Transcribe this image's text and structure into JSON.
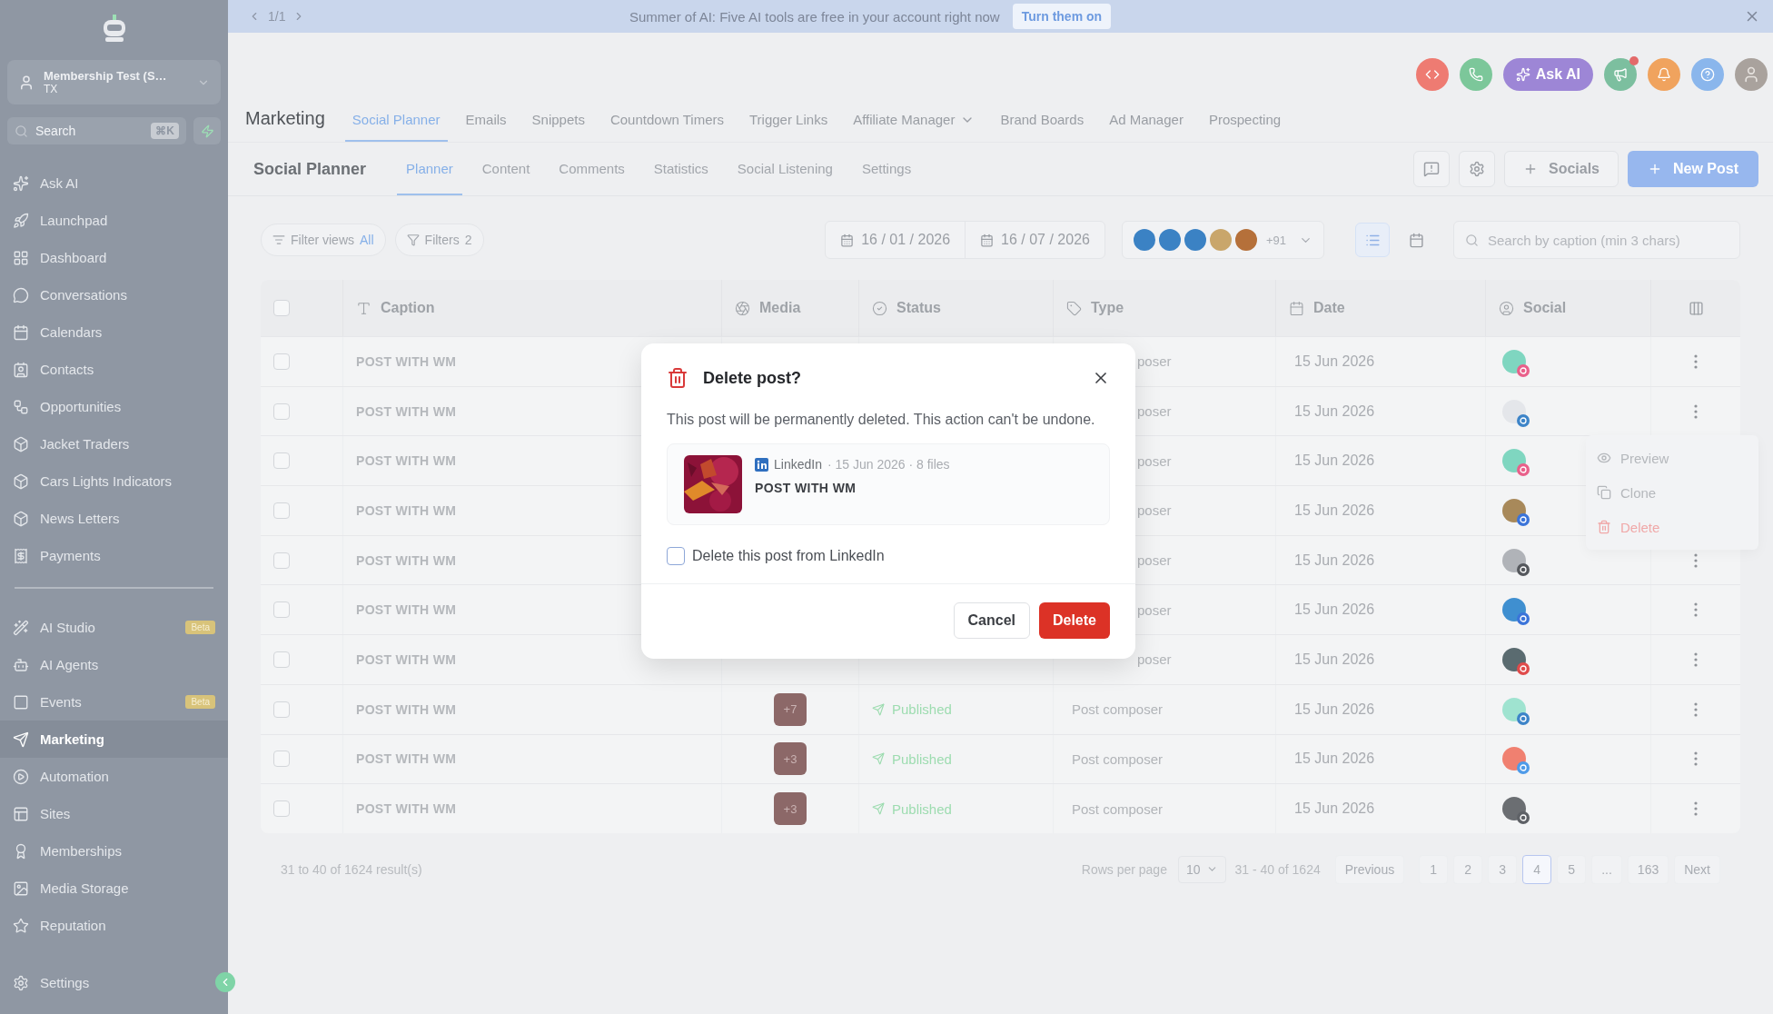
{
  "banner": {
    "pager": "1/1",
    "message": "Summer of AI: Five AI tools are free in your account right now",
    "action": "Turn them on"
  },
  "top_actions": {
    "ask_ai": "Ask AI"
  },
  "sidebar": {
    "account": {
      "name": "Membership Test (S…",
      "location": "TX"
    },
    "search": {
      "placeholder": "Search",
      "shortcut": "⌘K"
    },
    "items": [
      {
        "label": "Ask AI",
        "selected": false
      },
      {
        "label": "Launchpad",
        "selected": false
      },
      {
        "label": "Dashboard",
        "selected": false
      },
      {
        "label": "Conversations",
        "selected": false
      },
      {
        "label": "Calendars",
        "selected": false
      },
      {
        "label": "Contacts",
        "selected": false
      },
      {
        "label": "Opportunities",
        "selected": false
      },
      {
        "label": "Jacket Traders",
        "selected": false
      },
      {
        "label": "Cars Lights Indicators",
        "selected": false
      },
      {
        "label": "News Letters",
        "selected": false
      },
      {
        "label": "Payments",
        "selected": false
      }
    ],
    "items_2": [
      {
        "label": "AI Studio",
        "badge": "Beta",
        "selected": false
      },
      {
        "label": "AI Agents",
        "selected": false
      },
      {
        "label": "Events",
        "badge": "Beta",
        "selected": false
      },
      {
        "label": "Marketing",
        "selected": true
      },
      {
        "label": "Automation",
        "selected": false
      },
      {
        "label": "Sites",
        "selected": false
      },
      {
        "label": "Memberships",
        "selected": false
      },
      {
        "label": "Media Storage",
        "selected": false
      },
      {
        "label": "Reputation",
        "selected": false
      }
    ],
    "settings": "Settings"
  },
  "nav": {
    "title": "Marketing",
    "tabs": [
      {
        "label": "Social Planner",
        "selected": true
      },
      {
        "label": "Emails",
        "selected": false
      },
      {
        "label": "Snippets",
        "selected": false
      },
      {
        "label": "Countdown Timers",
        "selected": false
      },
      {
        "label": "Trigger Links",
        "selected": false
      },
      {
        "label": "Affiliate Manager",
        "dropdown": true,
        "selected": false
      },
      {
        "label": "Brand Boards",
        "selected": false
      },
      {
        "label": "Ad Manager",
        "selected": false
      },
      {
        "label": "Prospecting",
        "selected": false
      }
    ]
  },
  "subnav": {
    "title": "Social Planner",
    "tabs": [
      {
        "label": "Planner",
        "selected": true
      },
      {
        "label": "Content",
        "selected": false
      },
      {
        "label": "Comments",
        "selected": false
      },
      {
        "label": "Statistics",
        "selected": false
      },
      {
        "label": "Social Listening",
        "selected": false
      },
      {
        "label": "Settings",
        "selected": false
      }
    ],
    "socials": "Socials",
    "new_post": "New Post"
  },
  "filters": {
    "filter_views": "Filter views",
    "filter_views_value": "All",
    "filters": "Filters",
    "filters_count": "2",
    "date_from": "16 / 01 / 2026",
    "date_to": "16 / 07 / 2026",
    "accounts": [
      {
        "color": "#3b82c4"
      },
      {
        "color": "#3b82c4"
      },
      {
        "color": "#3b82c4"
      },
      {
        "color": "#c9a66b"
      },
      {
        "color": "#b5703a"
      }
    ],
    "more_accounts": "+91",
    "view_list_selected": true,
    "search_placeholder": "Search by caption (min 3 chars)"
  },
  "table": {
    "all_selected": false,
    "columns": [
      "Caption",
      "Media",
      "Status",
      "Type",
      "Date",
      "Social"
    ],
    "rows": [
      {
        "selected": false,
        "caption": "POST WITH WM",
        "type": "poser",
        "date": "15 Jun 2026",
        "kind": "instagram",
        "color": "#7fd6c0"
      },
      {
        "selected": false,
        "caption": "POST WITH WM",
        "type": "poser",
        "date": "15 Jun 2026",
        "kind": "linkedin",
        "color": "#e4e6ea"
      },
      {
        "selected": false,
        "caption": "POST WITH WM",
        "type": "poser",
        "date": "15 Jun 2026",
        "kind": "instagram",
        "color": "#7fd6c0"
      },
      {
        "selected": false,
        "caption": "POST WITH WM",
        "type": "poser",
        "date": "15 Jun 2026",
        "kind": "facebook",
        "color": "#a8895a"
      },
      {
        "selected": false,
        "caption": "POST WITH WM",
        "type": "poser",
        "date": "15 Jun 2026",
        "kind": "tiktok",
        "color": "#b0b3b8"
      },
      {
        "selected": false,
        "caption": "POST WITH WM",
        "type": "poser",
        "date": "15 Jun 2026",
        "kind": "facebook",
        "color": "#3f8fd0"
      },
      {
        "selected": false,
        "caption": "POST WITH WM",
        "type": "poser",
        "date": "15 Jun 2026",
        "kind": "pinterest",
        "color": "#5a6b70"
      },
      {
        "selected": false,
        "caption": "POST WITH WM",
        "media": "+7",
        "status": "Published",
        "type": "Post composer",
        "date": "15 Jun 2026",
        "kind": "linkedin",
        "color": "#9fe3d0"
      },
      {
        "selected": false,
        "caption": "POST WITH WM",
        "media": "+3",
        "status": "Published",
        "type": "Post composer",
        "date": "15 Jun 2026",
        "kind": "bluesky",
        "color": "#f08070"
      },
      {
        "selected": false,
        "caption": "POST WITH WM",
        "media": "+3",
        "status": "Published",
        "type": "Post composer",
        "date": "15 Jun 2026",
        "kind": "threads",
        "color": "#6b6e72"
      }
    ],
    "row_menu": [
      "Preview",
      "Clone",
      "Delete"
    ]
  },
  "pagination": {
    "summary": "31 to 40 of 1624 result(s)",
    "rows_per_page": "Rows per page",
    "rows_value": "10",
    "range": "31 - 40 of 1624",
    "previous": "Previous",
    "pages": [
      {
        "label": "1",
        "selected": false
      },
      {
        "label": "2",
        "selected": false
      },
      {
        "label": "3",
        "selected": false
      },
      {
        "label": "4",
        "selected": true
      },
      {
        "label": "5",
        "selected": false
      },
      {
        "label": "...",
        "selected": false
      },
      {
        "label": "163",
        "selected": false
      }
    ],
    "next": "Next"
  },
  "dialog": {
    "title": "Delete post?",
    "message": "This post will be permanently deleted. This action can't be undone.",
    "post": {
      "network": "LinkedIn",
      "meta": "· 15 Jun 2026 · 8 files",
      "caption": "POST WITH WM",
      "kind": "picture"
    },
    "checkbox": {
      "label": "Delete this post from LinkedIn",
      "checked": false
    },
    "cancel": "Cancel",
    "confirm": "Delete"
  }
}
